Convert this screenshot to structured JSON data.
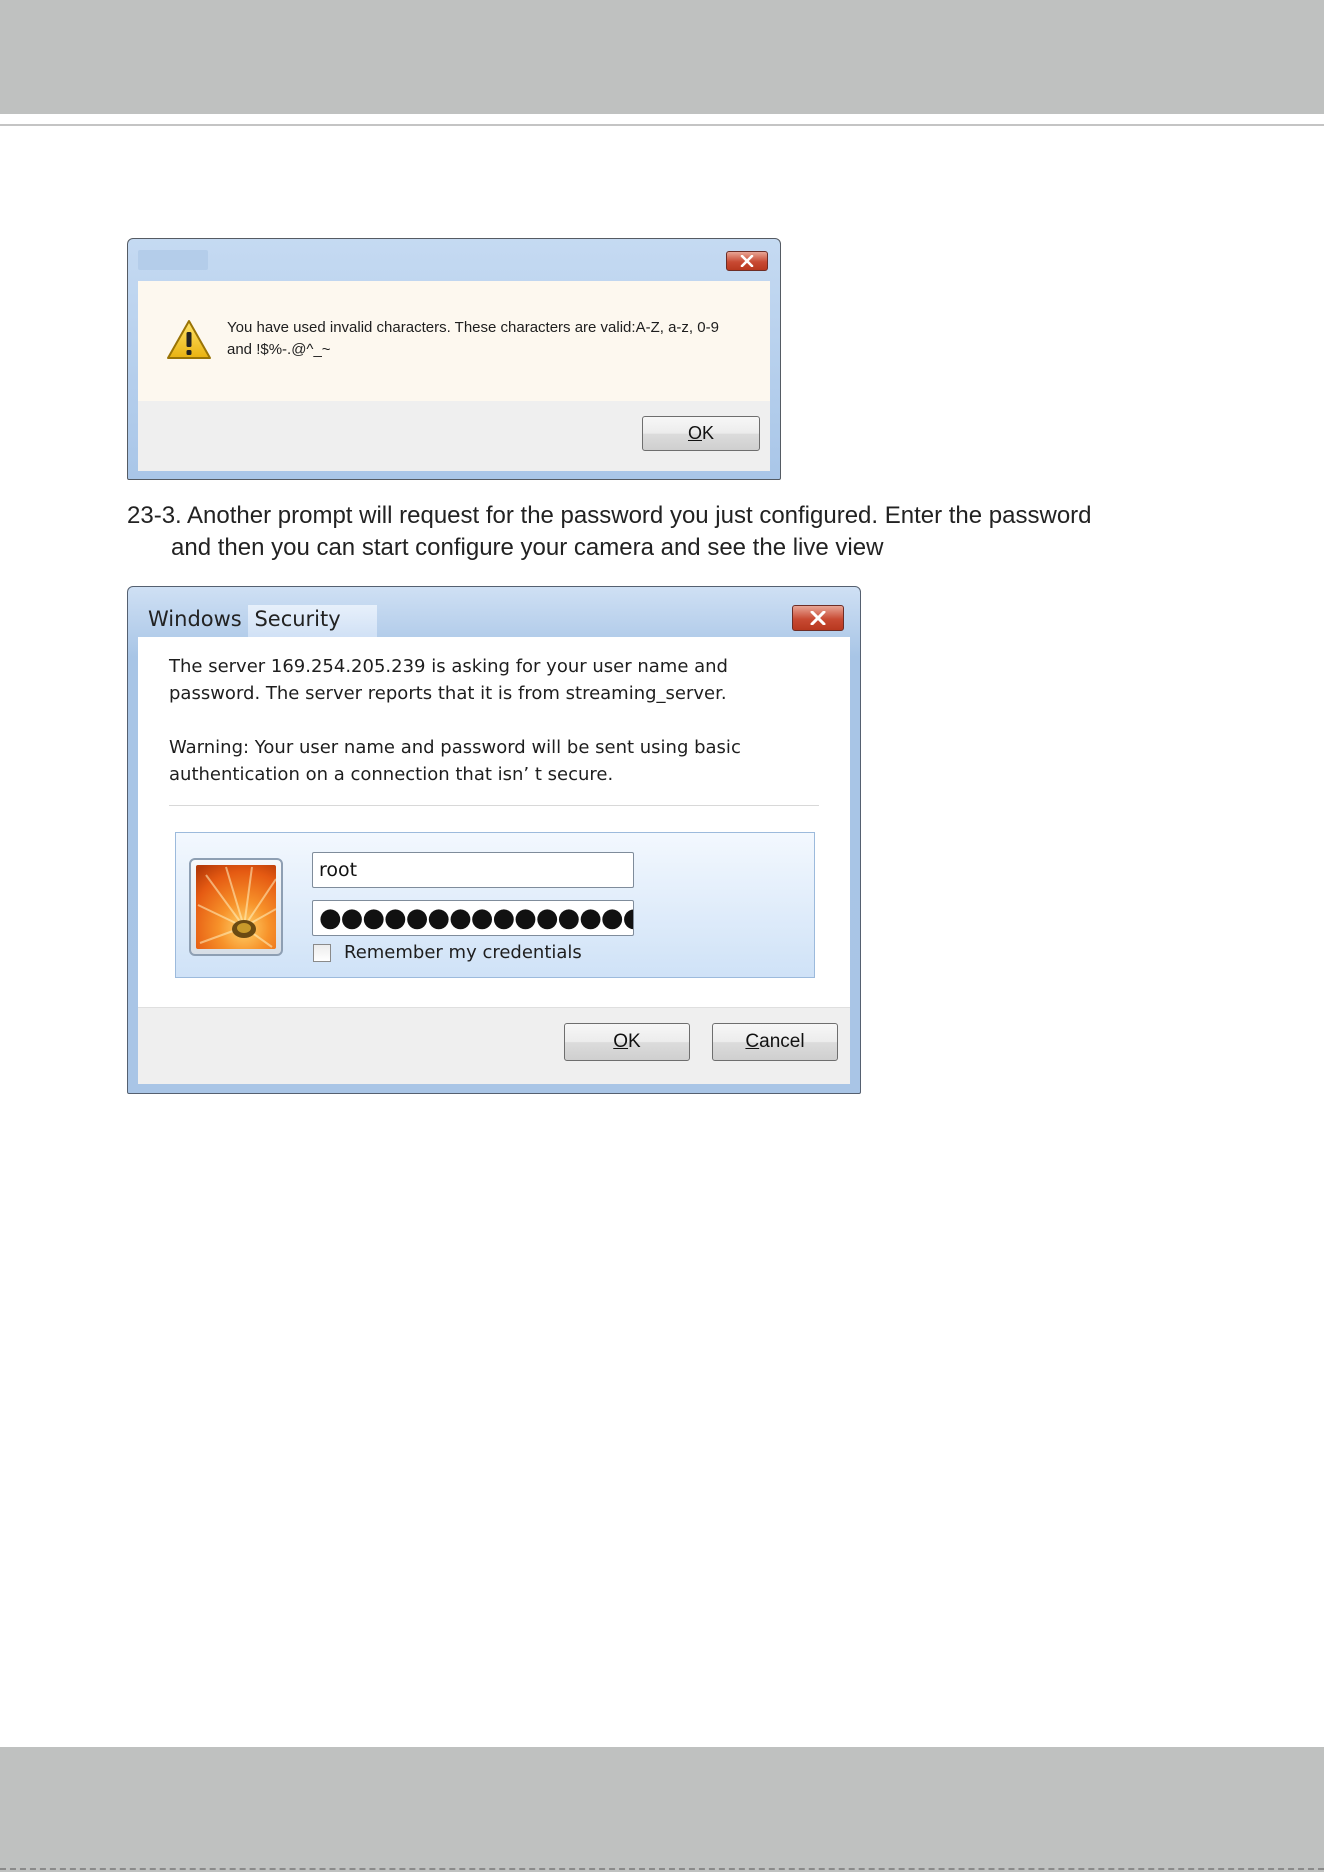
{
  "dialog_invalid": {
    "title": "",
    "message": "You have used invalid characters. These characters are valid:A-Z, a-z, 0-9 and !$%-.@^_~",
    "ok_key": "O",
    "ok_rest": "K"
  },
  "caption": {
    "line1": "23-3. Another prompt will request for the password you just configured. Enter the password",
    "line2": "and then you can start configure your camera and see the live view"
  },
  "dialog_security": {
    "title_part1": "Windows",
    "title_part2": "Security",
    "paragraph1": "The server 169.254.205.239 is asking for your user name and password. The server reports that it is from streaming_server.",
    "paragraph2": "Warning: Your user name and password will be sent using basic authentication on a connection that isn’ t secure.",
    "username_value": "root",
    "password_mask": "●●●●●●●●●●●●●●●",
    "remember_label": "Remember my credentials",
    "remember_checked": false,
    "ok_key": "O",
    "ok_rest": "K",
    "cancel_key": "C",
    "cancel_rest": "ancel"
  },
  "icons": {
    "warning": "warning-icon",
    "close": "close-icon",
    "user_tile": "flower-avatar-icon"
  },
  "colors": {
    "page_band": "#bfc1c0",
    "close_button": "#c84a33",
    "warning_yellow": "#f2c21c"
  }
}
